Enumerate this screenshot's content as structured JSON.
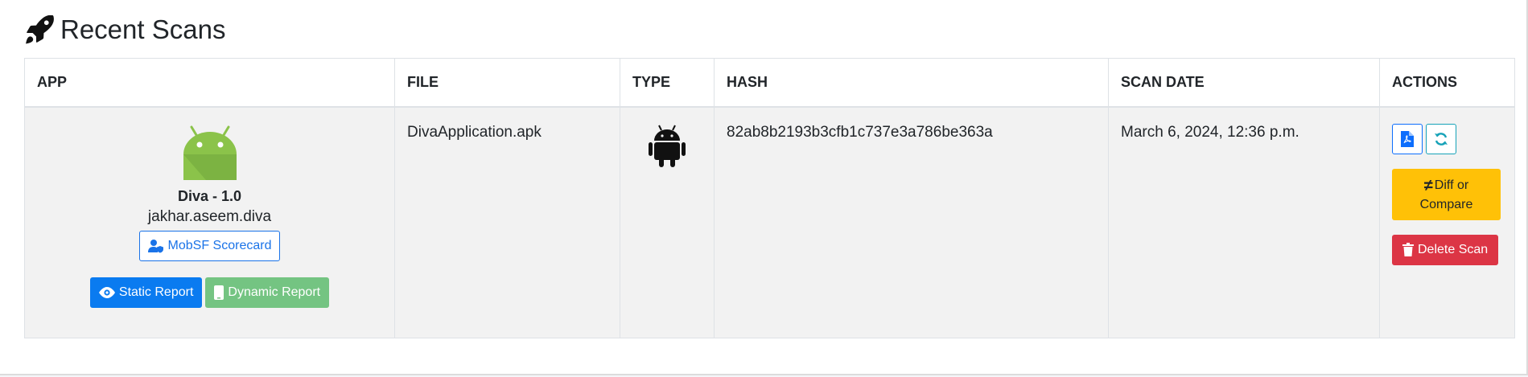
{
  "header": {
    "title": "Recent Scans",
    "icon": "rocket-icon"
  },
  "table": {
    "columns": [
      "APP",
      "FILE",
      "TYPE",
      "HASH",
      "SCAN DATE",
      "ACTIONS"
    ],
    "rows": [
      {
        "app_name": "Diva - 1.0",
        "package": "jakhar.aseem.diva",
        "scorecard_label": "MobSF Scorecard",
        "static_label": "Static Report",
        "dynamic_label": "Dynamic Report",
        "file": "DivaApplication.apk",
        "type_icon": "android-icon",
        "hash": "82ab8b2193b3cfb1c737e3a786be363a",
        "scan_date": "March 6, 2024, 12:36 p.m.",
        "actions": {
          "diff_label_1": "Diff or",
          "diff_label_2": "Compare",
          "delete_label": "Delete Scan"
        }
      }
    ]
  },
  "colors": {
    "primary": "#0a7bf0",
    "success": "#74c482",
    "warning": "#ffc107",
    "danger": "#dc3545",
    "android_green": "#8bc34a"
  }
}
